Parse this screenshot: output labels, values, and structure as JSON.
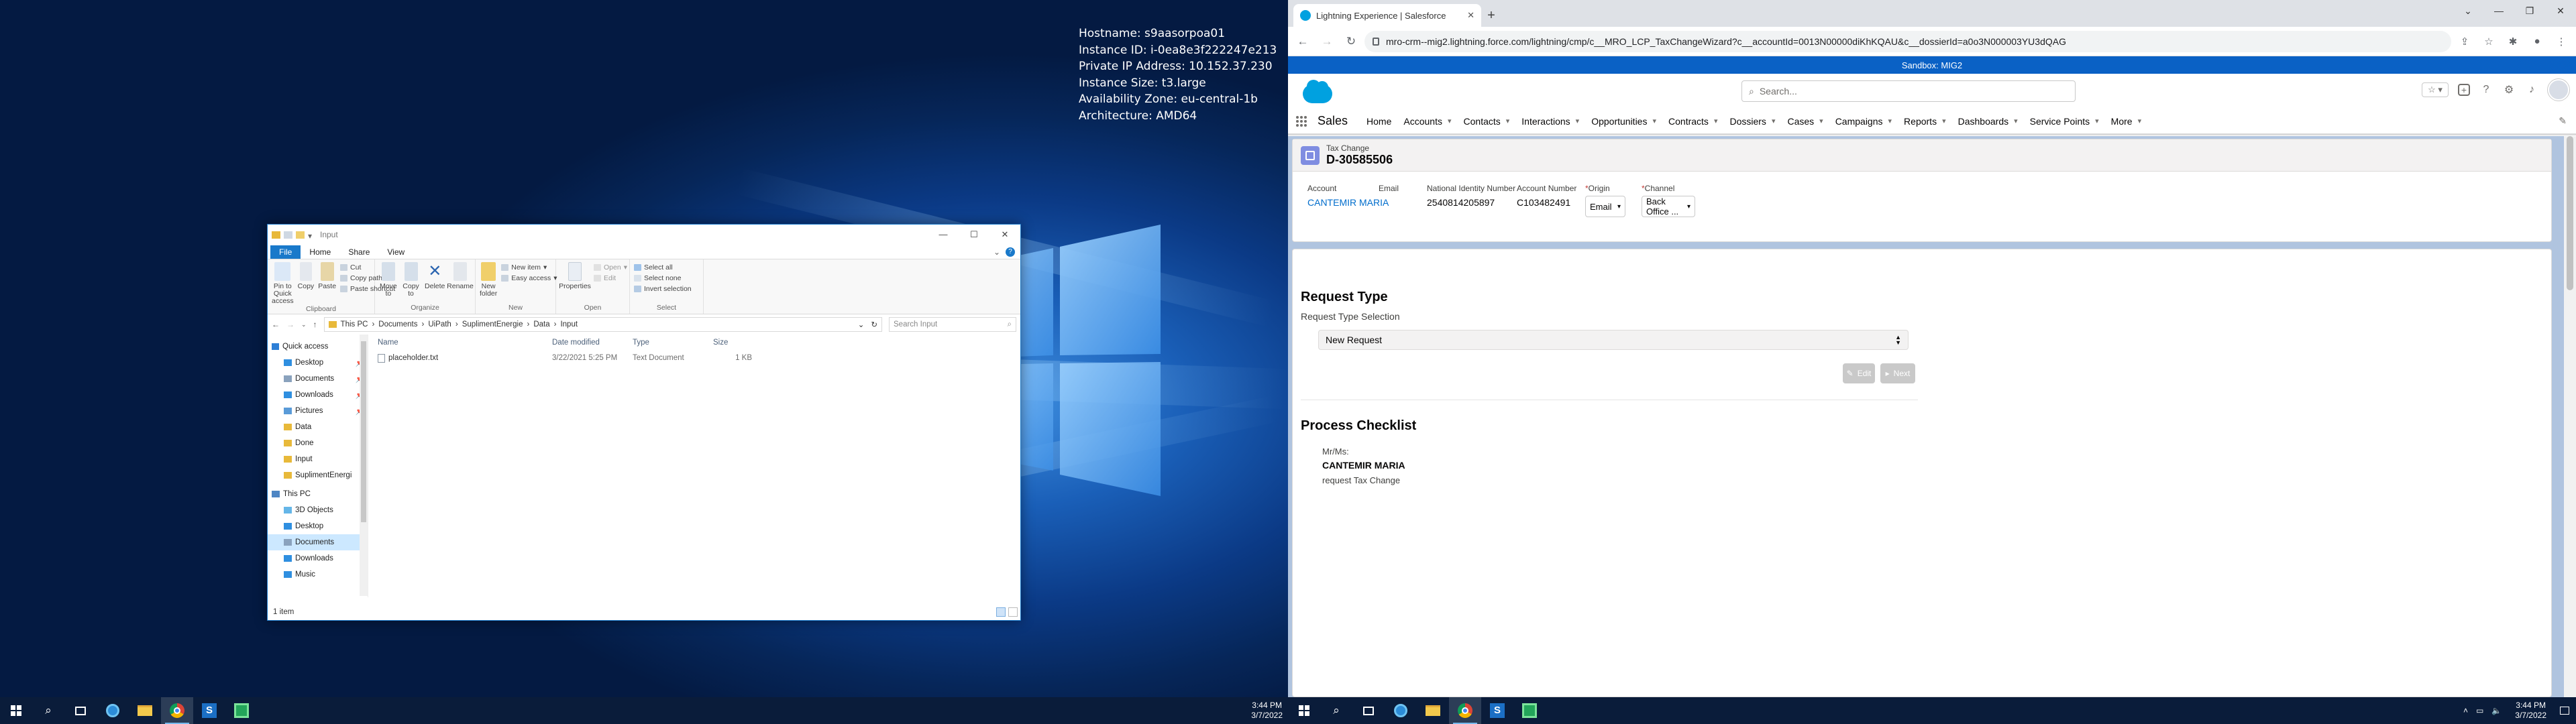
{
  "sysinfo": {
    "hostname": "Hostname: s9aasorpoa01",
    "instance_id": "Instance ID: i-0ea8e3f222247e213",
    "private_ip": "Private IP Address: 10.152.37.230",
    "instance_size": "Instance Size: t3.large",
    "availability_zone": "Availability Zone: eu-central-1b",
    "architecture": "Architecture: AMD64"
  },
  "explorer": {
    "title": "Input",
    "tabs": [
      "File",
      "Home",
      "Share",
      "View"
    ],
    "ribbon": {
      "clipboard": {
        "label": "Clipboard",
        "pin": "Pin to Quick access",
        "copy": "Copy",
        "paste": "Paste",
        "cut": "Cut",
        "copy_path": "Copy path",
        "paste_shortcut": "Paste shortcut"
      },
      "organize": {
        "label": "Organize",
        "move_to": "Move to",
        "copy_to": "Copy to",
        "delete": "Delete",
        "rename": "Rename"
      },
      "new": {
        "label": "New",
        "new_folder": "New folder",
        "new_item": "New item",
        "easy_access": "Easy access"
      },
      "open": {
        "label": "Open",
        "properties": "Properties",
        "open": "Open",
        "edit": "Edit"
      },
      "select": {
        "label": "Select",
        "select_all": "Select all",
        "select_none": "Select none",
        "invert": "Invert selection"
      }
    },
    "path": [
      "This PC",
      "Documents",
      "UiPath",
      "SuplimentEnergie",
      "Data",
      "Input"
    ],
    "search_placeholder": "Search Input",
    "nav": [
      {
        "label": "Quick access",
        "type": "header"
      },
      {
        "label": "Desktop",
        "pinned": true
      },
      {
        "label": "Documents",
        "pinned": true
      },
      {
        "label": "Downloads",
        "pinned": true
      },
      {
        "label": "Pictures",
        "pinned": true
      },
      {
        "label": "Data"
      },
      {
        "label": "Done"
      },
      {
        "label": "Input"
      },
      {
        "label": "SuplimentEnergi"
      },
      {
        "label": "This PC",
        "type": "header"
      },
      {
        "label": "3D Objects"
      },
      {
        "label": "Desktop"
      },
      {
        "label": "Documents",
        "selected": true
      },
      {
        "label": "Downloads"
      },
      {
        "label": "Music"
      }
    ],
    "columns": [
      "Name",
      "Date modified",
      "Type",
      "Size"
    ],
    "files": [
      {
        "name": "placeholder.txt",
        "date": "3/22/2021 5:25 PM",
        "type": "Text Document",
        "size": "1 KB"
      }
    ],
    "status": "1 item"
  },
  "taskbar_left": {
    "time": "3:44 PM",
    "date": "3/7/2022"
  },
  "taskbar_right": {
    "time": "3:44 PM",
    "date": "3/7/2022"
  },
  "chrome": {
    "tab_title": "Lightning Experience | Salesforce",
    "url": "mro-crm--mig2.lightning.force.com/lightning/cmp/c__MRO_LCP_TaxChangeWizard?c__accountId=0013N00000diKhKQAU&c__dossierId=a0o3N000003YU3dQAG"
  },
  "sf": {
    "sandbox": "Sandbox: MIG2",
    "search_placeholder": "Search...",
    "app_name": "Sales",
    "nav": [
      "Home",
      "Accounts",
      "Contacts",
      "Interactions",
      "Opportunities",
      "Contracts",
      "Dossiers",
      "Cases",
      "Campaigns",
      "Reports",
      "Dashboards",
      "Service Points",
      "More"
    ],
    "record": {
      "type": "Tax Change",
      "id": "D-30585506"
    },
    "fields": {
      "account_label": "Account",
      "account_value": "CANTEMIR MARIA",
      "email_label": "Email",
      "nin_label": "National Identity Number",
      "nin_value": "2540814205897",
      "accnum_label": "Account Number",
      "accnum_value": "C103482491",
      "origin_label": "Origin",
      "origin_value": "Email",
      "channel_label": "Channel",
      "channel_value": "Back Office ..."
    },
    "request": {
      "title": "Request Type",
      "subtitle": "Request Type Selection",
      "value": "New Request",
      "edit": "Edit",
      "next": "Next"
    },
    "checklist": {
      "title": "Process Checklist",
      "salutation": "Mr/Ms:",
      "name": "CANTEMIR MARIA",
      "line": "request Tax Change"
    }
  }
}
